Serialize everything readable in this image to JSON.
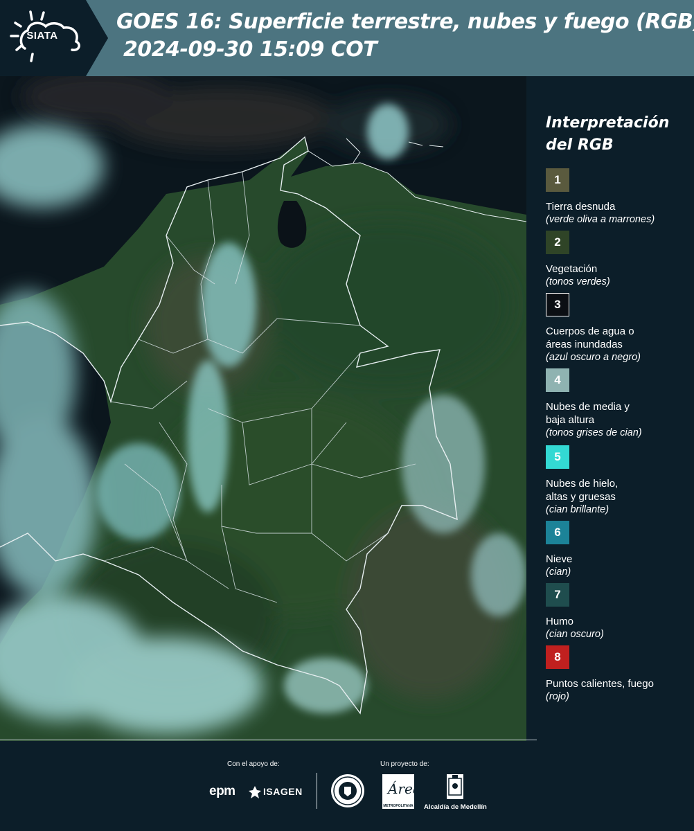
{
  "header": {
    "logo_text": "SIATA",
    "title_line1": "GOES 16: Superficie terrestre, nubes y fuego (RGB)",
    "title_line2": "2024-09-30 15:09 COT",
    "band_color": "#4c7480",
    "logo_bg_color": "#0c1e29"
  },
  "legend": {
    "title": "Interpretación del RGB",
    "items": [
      {
        "number": "1",
        "label": "Tierra desnuda",
        "description": "(verde oliva a marrones)",
        "color": "#5a5a3e"
      },
      {
        "number": "2",
        "label": "Vegetación",
        "description": "(tonos verdes)",
        "color": "#2f4427"
      },
      {
        "number": "3",
        "label": "Cuerpos de agua o áreas inundadas",
        "description": "(azul oscuro a negro)",
        "color": "#0b0f14"
      },
      {
        "number": "4",
        "label": "Nubes de media y baja altura",
        "description": "(tonos grises de cian)",
        "color": "#8fb3b1"
      },
      {
        "number": "5",
        "label": "Nubes de hielo, altas y gruesas",
        "description": "(cian brillante)",
        "color": "#33d9d3"
      },
      {
        "number": "6",
        "label": "Nieve",
        "description": "(cian)",
        "color": "#1c8398"
      },
      {
        "number": "7",
        "label": "Humo",
        "description": "(cian oscuro)",
        "color": "#1f4d4e"
      },
      {
        "number": "8",
        "label": "Puntos calientes, fuego",
        "description": "(rojo)",
        "color": "#c0201f"
      }
    ]
  },
  "footer": {
    "support_caption": "Con el apoyo de:",
    "project_caption": "Un proyecto de:",
    "sponsors": [
      "epm",
      "ISAGEN"
    ],
    "area_metro_caption": "METROPOLITANA",
    "alcaldia_caption": "Alcaldía de Medellín"
  }
}
